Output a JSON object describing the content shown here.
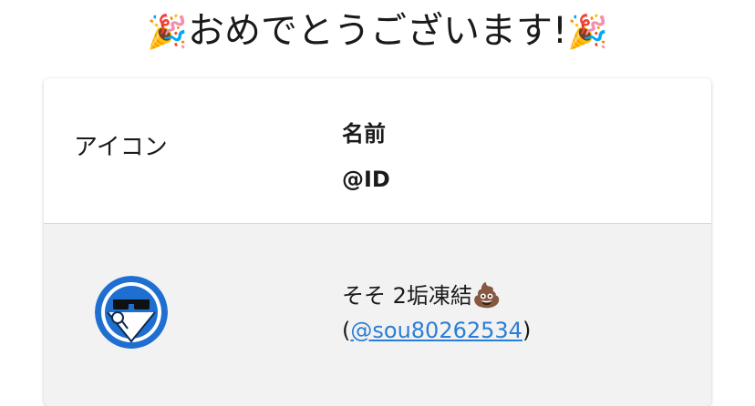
{
  "header": {
    "title_emoji_left": "🎉",
    "title_text": "おめでとうございます!",
    "title_emoji_right": "🎉"
  },
  "table": {
    "headers": {
      "icon": "アイコン",
      "name": "名前",
      "id": "@ID"
    },
    "rows": [
      {
        "avatar_icon": "sunglasses-avatar-icon",
        "display_name": "そそ 2垢凍結",
        "name_emoji": "💩",
        "handle_open": "(",
        "handle": "@sou80262534",
        "handle_close": ")"
      }
    ]
  },
  "colors": {
    "link": "#2a7ed6",
    "row_background": "#f2f2f2",
    "avatar_blue": "#1f6fd1"
  }
}
